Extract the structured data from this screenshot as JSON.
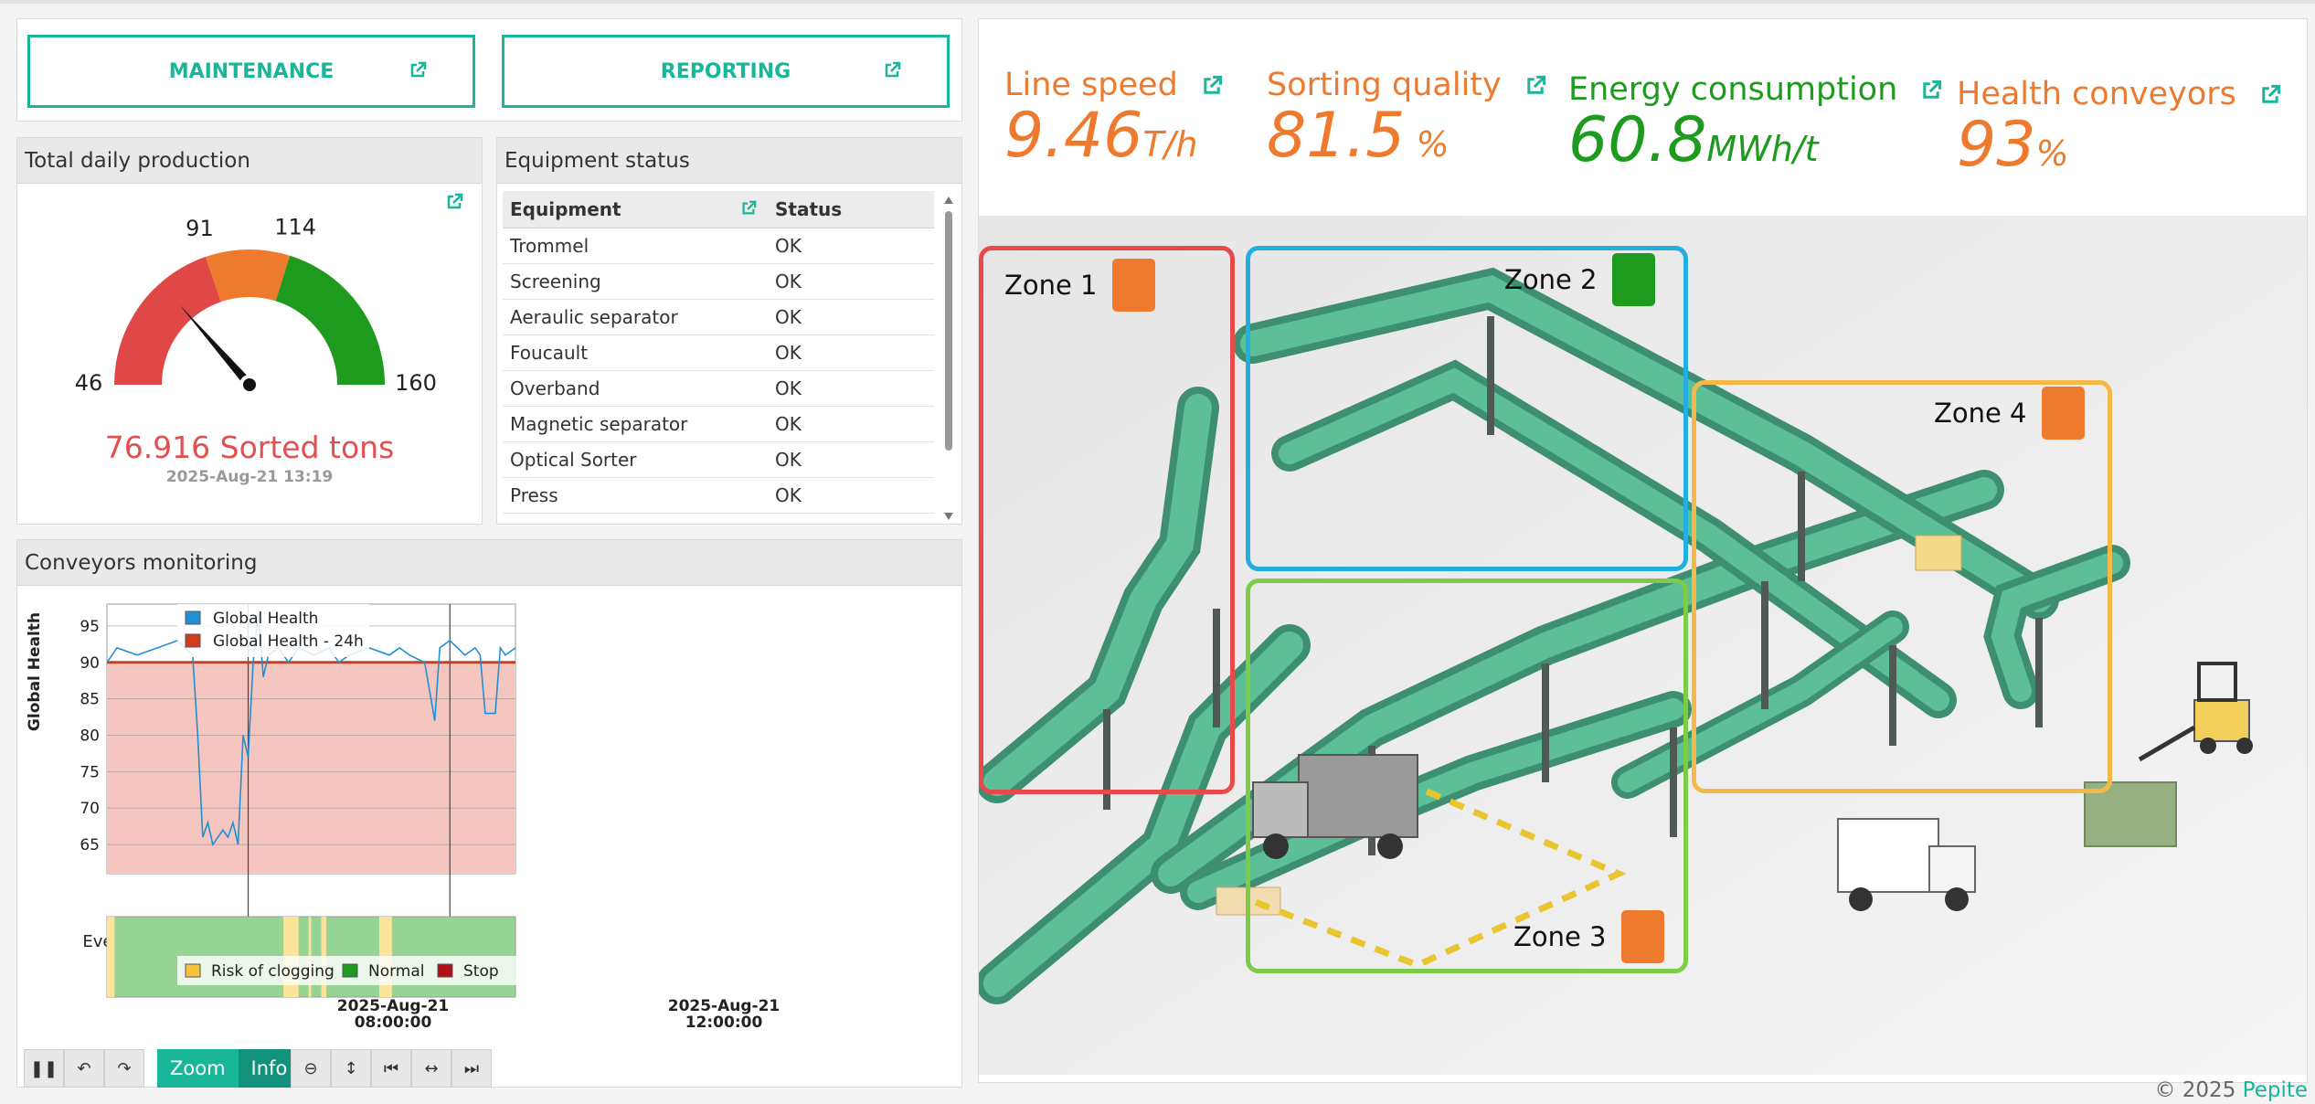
{
  "buttons": {
    "maintenance": "MAINTENANCE",
    "reporting": "REPORTING"
  },
  "production": {
    "title": "Total daily production",
    "gauge": {
      "min": 46,
      "max": 160,
      "t1": 91,
      "t2": 114,
      "value": 76.916
    },
    "min_label": "46",
    "max_label": "160",
    "t1_label": "91",
    "t2_label": "114",
    "value_text": "76.916 Sorted tons",
    "timestamp": "2025-Aug-21 13:19",
    "colors": {
      "low": "#e04848",
      "mid": "#ee7a2e",
      "high": "#1e9a1e"
    }
  },
  "equipment": {
    "title": "Equipment status",
    "headers": {
      "equipment": "Equipment",
      "status": "Status"
    },
    "rows": [
      {
        "name": "Trommel",
        "status": "OK"
      },
      {
        "name": "Screening",
        "status": "OK"
      },
      {
        "name": "Aeraulic separator",
        "status": "OK"
      },
      {
        "name": "Foucault",
        "status": "OK"
      },
      {
        "name": "Overband",
        "status": "OK"
      },
      {
        "name": "Magnetic separator",
        "status": "OK"
      },
      {
        "name": "Optical Sorter",
        "status": "OK"
      },
      {
        "name": "Press",
        "status": "OK"
      }
    ]
  },
  "conveyors": {
    "title": "Conveyors monitoring",
    "ylabel": "Global Health",
    "event_label": "Event -EN",
    "legend": {
      "health": "Global Health",
      "health24": "Global Health - 24h"
    },
    "event_legend": {
      "risk": "Risk of clogging",
      "normal": "Normal",
      "stop": "Stop"
    },
    "x_ticks": [
      {
        "date": "2025-Aug-21",
        "time": "08:00:00"
      },
      {
        "date": "2025-Aug-21",
        "time": "12:00:00"
      }
    ],
    "controls": {
      "zoom": "Zoom",
      "info": "Info"
    }
  },
  "chart_data": {
    "type": "line",
    "ylabel": "Global Health",
    "ylim": [
      61,
      98
    ],
    "y_ticks": [
      65,
      70,
      75,
      80,
      85,
      90,
      95
    ],
    "threshold": 90,
    "x_ticks": [
      "2025-Aug-21 08:00:00",
      "2025-Aug-21 12:00:00"
    ],
    "series": [
      {
        "name": "Global Health",
        "color": "#1f8fd6",
        "x_hours": [
          5.2,
          5.4,
          5.8,
          6.2,
          6.6,
          6.9,
          7.0,
          7.1,
          7.2,
          7.3,
          7.5,
          7.6,
          7.7,
          7.8,
          7.9,
          8.0,
          8.1,
          8.2,
          8.3,
          8.4,
          8.6,
          8.8,
          9.0,
          9.3,
          9.6,
          9.8,
          10.0,
          10.4,
          10.8,
          11.0,
          11.2,
          11.5,
          11.6,
          11.7,
          11.8,
          12.0,
          12.3,
          12.5,
          12.6,
          12.7,
          12.9,
          13.0,
          13.1,
          13.3
        ],
        "y": [
          90,
          92,
          91,
          92,
          93,
          91,
          80,
          66,
          68,
          65,
          67,
          66,
          68,
          65,
          80,
          77,
          90,
          97,
          88,
          91,
          92,
          90,
          92,
          91,
          92,
          90,
          91,
          92,
          91,
          92,
          91,
          90,
          86,
          82,
          92,
          93,
          91,
          92,
          91,
          83,
          83,
          92,
          91,
          92
        ]
      },
      {
        "name": "Global Health - 24h",
        "color": "#d23c1e",
        "x_hours": [
          5.2,
          13.3
        ],
        "y": [
          90,
          90
        ]
      }
    ]
  },
  "kpis": [
    {
      "label": "Line speed",
      "value": "9.46",
      "unit": "T/h",
      "color": "#ee7a2e"
    },
    {
      "label": "Sorting quality",
      "value": "81.5",
      "unit": " %",
      "color": "#ee7a2e"
    },
    {
      "label": "Energy consumption",
      "value": "60.8",
      "unit": "MWh/t",
      "color": "#1e9a1e"
    },
    {
      "label": "Health conveyors",
      "value": "93",
      "unit": "%",
      "color": "#ee7a2e"
    }
  ],
  "zones": [
    {
      "label": "Zone 1",
      "border": "#e84a4a",
      "status": "#ee7a2e"
    },
    {
      "label": "Zone 2",
      "border": "#22aee0",
      "status": "#1e9a1e"
    },
    {
      "label": "Zone 3",
      "border": "#7ccc4a",
      "status": "#ee7a2e"
    },
    {
      "label": "Zone 4",
      "border": "#f5b94a",
      "status": "#ee7a2e"
    }
  ],
  "footer": {
    "copyright": "© 2025 ",
    "brand": "Pepite"
  }
}
